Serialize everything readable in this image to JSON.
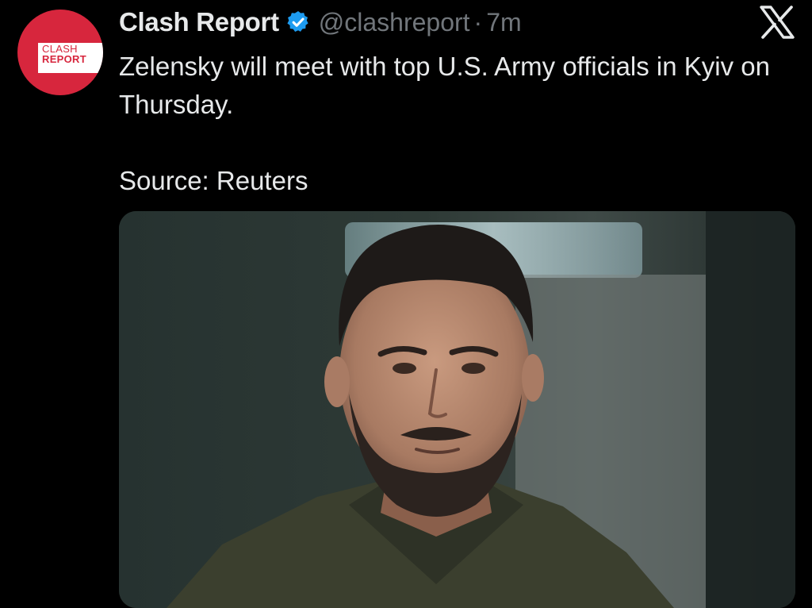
{
  "tweet": {
    "author": {
      "display_name": "Clash Report",
      "handle": "@clashreport",
      "verified": true,
      "avatar_logo_top": "CLASH",
      "avatar_logo_bottom": "REPORT"
    },
    "separator": "·",
    "time": "7m",
    "text": "Zelensky will meet with top U.S. Army officials in Kyiv on Thursday.\n\nSource: Reuters"
  },
  "icons": {
    "verified": "verified-badge-icon",
    "platform": "x-logo-icon"
  },
  "colors": {
    "background": "#000000",
    "primary_text": "#e7e9ea",
    "secondary_text": "#71767b",
    "verified_blue": "#1d9bf0",
    "avatar_red": "#d7263d"
  }
}
